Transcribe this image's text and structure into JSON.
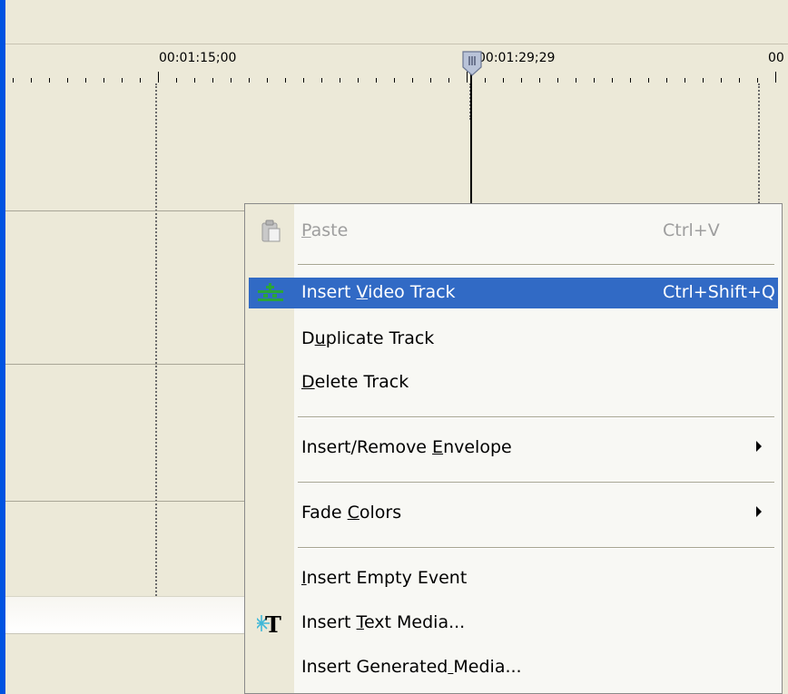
{
  "timeline": {
    "ruler_labels": [
      "00:01:15;00",
      "00:01:29;29",
      "00"
    ]
  },
  "context_menu": {
    "items": [
      {
        "label": "Paste",
        "mnemonic_index": 0,
        "shortcut": "Ctrl+V",
        "enabled": false,
        "icon": "paste-icon"
      },
      {
        "label": "Insert Video Track",
        "mnemonic_index": 7,
        "shortcut": "Ctrl+Shift+Q",
        "enabled": true,
        "highlighted": true,
        "icon": "insert-track-icon"
      },
      {
        "label": "Duplicate Track",
        "mnemonic_index": 1,
        "shortcut": "",
        "enabled": true
      },
      {
        "label": "Delete Track",
        "mnemonic_index": 0,
        "shortcut": "",
        "enabled": true
      },
      {
        "label": "Insert/Remove Envelope",
        "mnemonic_index": 14,
        "shortcut": "",
        "enabled": true,
        "submenu": true
      },
      {
        "label": "Fade Colors",
        "mnemonic_index": 5,
        "shortcut": "",
        "enabled": true,
        "submenu": true
      },
      {
        "label": "Insert Empty Event",
        "mnemonic_index": 0,
        "shortcut": "",
        "enabled": true
      },
      {
        "label": "Insert Text Media...",
        "mnemonic_index": 7,
        "shortcut": "",
        "enabled": true,
        "icon": "text-media-icon"
      },
      {
        "label": "Insert Generated Media...",
        "mnemonic_index": 16,
        "shortcut": "",
        "enabled": true
      }
    ]
  },
  "colors": {
    "frame": "#0053e1",
    "background": "#ece9d8",
    "highlight": "#316ac5",
    "menu_bg": "#f8f8f4"
  }
}
